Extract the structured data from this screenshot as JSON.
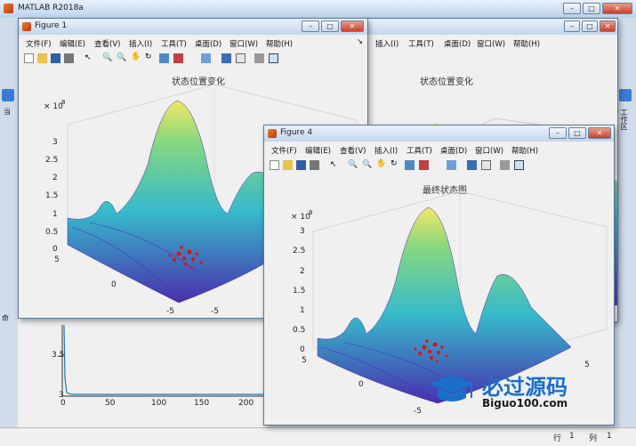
{
  "main_window": {
    "title": "MATLAB R2018a",
    "right_tab": "工作区",
    "left_tab_a": "当",
    "left_tab_b": "命",
    "status_row_label": "行",
    "status_row_value": "1",
    "status_col_label": "列",
    "status_col_value": "1"
  },
  "back_plot": {
    "y_ticks": [
      "3.5",
      "3"
    ],
    "x_ticks": [
      "0",
      "50",
      "100",
      "150",
      "200"
    ]
  },
  "figure1": {
    "title": "Figure 1",
    "menus": [
      "文件(F)",
      "编辑(E)",
      "查看(V)",
      "插入(I)",
      "工具(T)",
      "桌面(D)",
      "窗口(W)",
      "帮助(H)"
    ],
    "axes_title": "状态位置变化",
    "exponent_base": "× 10",
    "exponent_power": "8",
    "z_ticks": [
      "3",
      "2.5",
      "2",
      "1.5",
      "1",
      "0.5",
      "0"
    ],
    "y_ticks": [
      "5",
      "0",
      "-5"
    ],
    "x_ticks": [
      "-5"
    ]
  },
  "figure_behind": {
    "menus": [
      "插入(I)",
      "工具(T)",
      "桌面(D)",
      "窗口(W)",
      "帮助(H)"
    ],
    "axes_title": "状态位置变化"
  },
  "figure4": {
    "title": "Figure 4",
    "menus": [
      "文件(F)",
      "编辑(E)",
      "查看(V)",
      "插入(I)",
      "工具(T)",
      "桌面(D)",
      "窗口(W)",
      "帮助(H)"
    ],
    "axes_title": "最终状态图",
    "exponent_base": "× 10",
    "exponent_power": "8",
    "z_ticks": [
      "3",
      "2.5",
      "2",
      "1.5",
      "1",
      "0.5",
      "0"
    ],
    "y_ticks": [
      "5",
      "0",
      "-5"
    ],
    "x_ticks": [
      "5"
    ]
  },
  "watermark": {
    "brand": "必过源码",
    "domain": "Biguo100.com"
  },
  "colors": {
    "surface_low": "#3b1fa8",
    "surface_mid": "#27b6c8",
    "surface_high": "#f5e75a",
    "particles": "#e01010",
    "close_button": "#c8422d"
  }
}
